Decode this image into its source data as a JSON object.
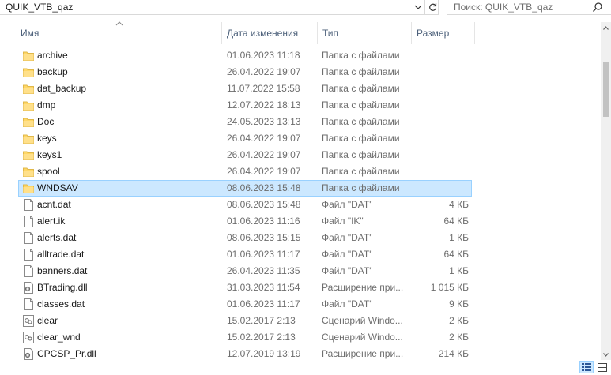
{
  "address": {
    "path": "QUIK_VTB_qaz"
  },
  "search": {
    "placeholder": "Поиск: QUIK_VTB_qaz"
  },
  "columns": {
    "name": "Имя",
    "date": "Дата изменения",
    "type": "Тип",
    "size": "Размер"
  },
  "files": [
    {
      "name": "archive",
      "date": "01.06.2023 11:18",
      "type": "Папка с файлами",
      "size": "",
      "icon": "folder-icon"
    },
    {
      "name": "backup",
      "date": "26.04.2022 19:07",
      "type": "Папка с файлами",
      "size": "",
      "icon": "folder-icon"
    },
    {
      "name": "dat_backup",
      "date": "11.07.2022 15:58",
      "type": "Папка с файлами",
      "size": "",
      "icon": "folder-icon"
    },
    {
      "name": "dmp",
      "date": "12.07.2022 18:13",
      "type": "Папка с файлами",
      "size": "",
      "icon": "folder-icon"
    },
    {
      "name": "Doc",
      "date": "24.05.2023 13:13",
      "type": "Папка с файлами",
      "size": "",
      "icon": "folder-icon"
    },
    {
      "name": "keys",
      "date": "26.04.2022 19:07",
      "type": "Папка с файлами",
      "size": "",
      "icon": "folder-icon"
    },
    {
      "name": "keys1",
      "date": "26.04.2022 19:07",
      "type": "Папка с файлами",
      "size": "",
      "icon": "folder-icon"
    },
    {
      "name": "spool",
      "date": "26.04.2022 19:07",
      "type": "Папка с файлами",
      "size": "",
      "icon": "folder-icon"
    },
    {
      "name": "WNDSAV",
      "date": "08.06.2023 15:48",
      "type": "Папка с файлами",
      "size": "",
      "icon": "folder-icon",
      "selected": true
    },
    {
      "name": "acnt.dat",
      "date": "08.06.2023 15:48",
      "type": "Файл \"DAT\"",
      "size": "4 КБ",
      "icon": "file-icon"
    },
    {
      "name": "alert.ik",
      "date": "01.06.2023 11:16",
      "type": "Файл \"IK\"",
      "size": "64 КБ",
      "icon": "file-icon"
    },
    {
      "name": "alerts.dat",
      "date": "08.06.2023 15:15",
      "type": "Файл \"DAT\"",
      "size": "1 КБ",
      "icon": "file-icon"
    },
    {
      "name": "alltrade.dat",
      "date": "01.06.2023 11:17",
      "type": "Файл \"DAT\"",
      "size": "64 КБ",
      "icon": "file-icon"
    },
    {
      "name": "banners.dat",
      "date": "26.04.2023 11:35",
      "type": "Файл \"DAT\"",
      "size": "1 КБ",
      "icon": "file-icon"
    },
    {
      "name": "BTrading.dll",
      "date": "31.03.2023 11:54",
      "type": "Расширение при...",
      "size": "1 015 КБ",
      "icon": "dll-icon"
    },
    {
      "name": "classes.dat",
      "date": "01.06.2023 11:17",
      "type": "Файл \"DAT\"",
      "size": "9 КБ",
      "icon": "file-icon"
    },
    {
      "name": "clear",
      "date": "15.02.2017 2:13",
      "type": "Сценарий Windo...",
      "size": "2 КБ",
      "icon": "script-icon"
    },
    {
      "name": "clear_wnd",
      "date": "15.02.2017 2:13",
      "type": "Сценарий Windo...",
      "size": "2 КБ",
      "icon": "script-icon"
    },
    {
      "name": "CPCSP_Pr.dll",
      "date": "12.07.2019 13:19",
      "type": "Расширение при...",
      "size": "214 КБ",
      "icon": "dll-icon"
    }
  ],
  "colors": {
    "selection_bg": "#cce8ff",
    "selection_border": "#99d1ff",
    "folder": "#ffd766",
    "header_text": "#4c607a"
  }
}
